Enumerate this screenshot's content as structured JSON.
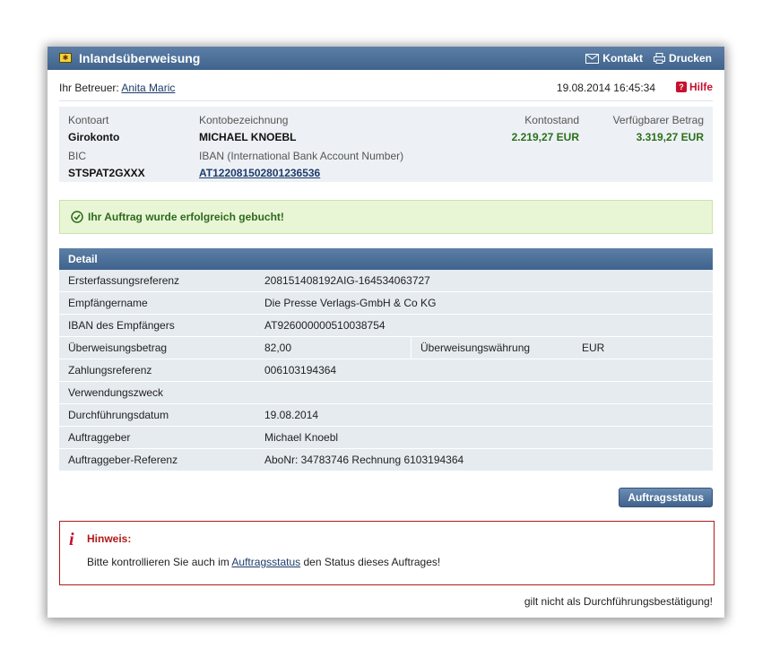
{
  "window": {
    "title": "Inlandsüberweisung",
    "actions": {
      "kontakt": "Kontakt",
      "drucken": "Drucken"
    }
  },
  "betreuer": {
    "label": "Ihr Betreuer:",
    "name": "Anita Maric",
    "datetime": "19.08.2014 16:45:34",
    "hilfe": "Hilfe"
  },
  "account": {
    "kontoart_label": "Kontoart",
    "kontoart": "Girokonto",
    "bezeichnung_label": "Kontobezeichnung",
    "bezeichnung": "MICHAEL KNOEBL",
    "kontostand_label": "Kontostand",
    "kontostand": "2.219,27 EUR",
    "verfuegbar_label": "Verfügbarer Betrag",
    "verfuegbar": "3.319,27 EUR",
    "bic_label": "BIC",
    "bic": "STSPAT2GXXX",
    "iban_label": "IBAN (International Bank Account Number)",
    "iban": "AT122081502801236536"
  },
  "success_message": "Ihr Auftrag wurde erfolgreich gebucht!",
  "detail": {
    "header": "Detail",
    "rows": [
      {
        "label": "Ersterfassungsreferenz",
        "value": "208151408192AIG-164534063727"
      },
      {
        "label": "Empfängername",
        "value": "Die Presse Verlags-GmbH & Co KG"
      },
      {
        "label": "IBAN des Empfängers",
        "value": "AT926000000510038754"
      },
      {
        "label": "Überweisungsbetrag",
        "value": "82,00",
        "label2": "Überweisungswährung",
        "value2": "EUR"
      },
      {
        "label": "Zahlungsreferenz",
        "value": "006103194364"
      },
      {
        "label": "Verwendungszweck",
        "value": ""
      },
      {
        "label": "Durchführungsdatum",
        "value": "19.08.2014"
      },
      {
        "label": "Auftraggeber",
        "value": "Michael Knoebl"
      },
      {
        "label": "Auftraggeber-Referenz",
        "value": "AboNr: 34783746 Rechnung 6103194364"
      }
    ]
  },
  "status_button": "Auftragsstatus",
  "hinweis": {
    "title": "Hinweis:",
    "text_before": "Bitte kontrollieren Sie auch im ",
    "link": "Auftragsstatus",
    "text_after": " den Status dieses Auftrages!"
  },
  "footer_note": "gilt nicht als Durchführungsbestätigung!",
  "colors": {
    "header_blue": "#3f638d",
    "success_green": "#2d6a1c",
    "warning_red": "#b11a1a"
  }
}
